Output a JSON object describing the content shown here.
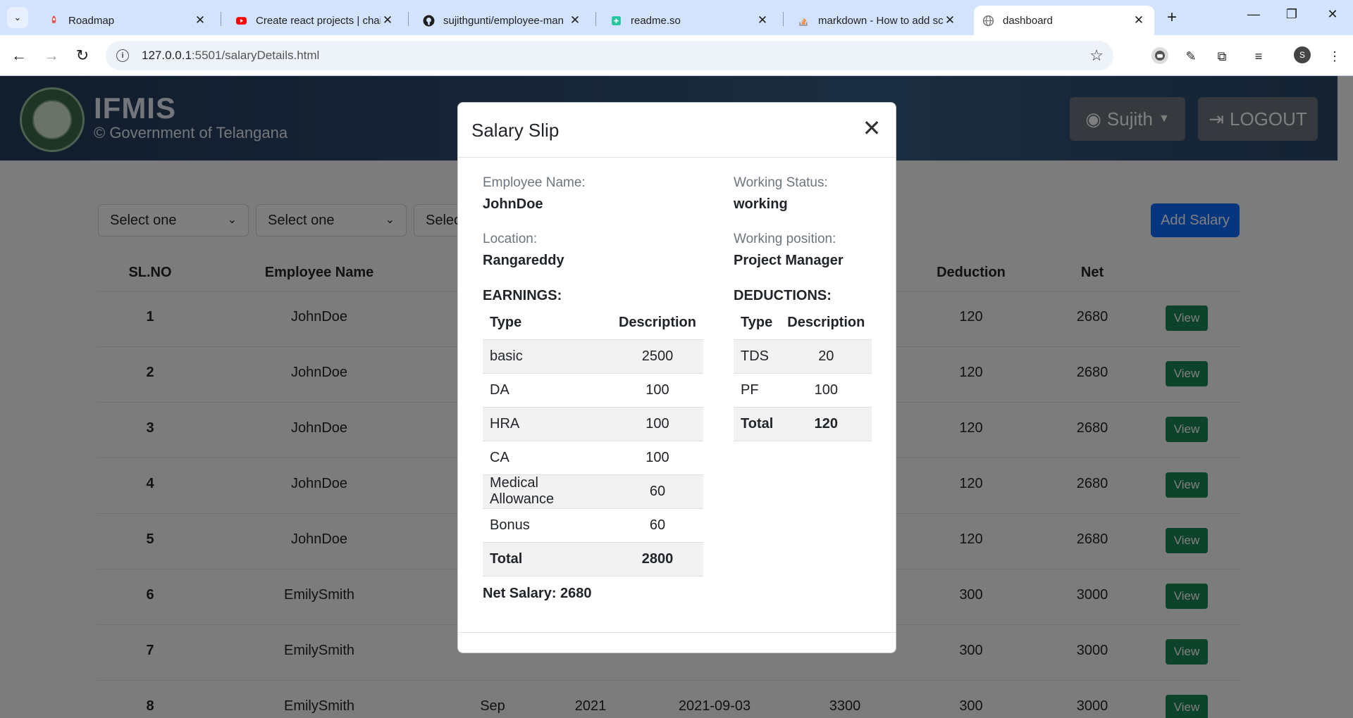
{
  "browser": {
    "tabs": [
      {
        "title": "Roadmap",
        "icon": "roadmap-rocket-icon"
      },
      {
        "title": "Create react projects | chai",
        "icon": "youtube-icon"
      },
      {
        "title": "sujithgunti/employee-man",
        "icon": "github-icon"
      },
      {
        "title": "readme.so",
        "icon": "readme-icon"
      },
      {
        "title": "markdown - How to add sc",
        "icon": "stackoverflow-icon"
      },
      {
        "title": "dashboard",
        "icon": "globe-icon"
      }
    ],
    "url_host": "127.0.0.1",
    "url_path": ":5501/salaryDetails.html",
    "profile_initial": "S"
  },
  "header": {
    "brand_title": "IFMIS",
    "brand_subtitle": "© Government of Telangana",
    "user_label": "Sujith",
    "logout_label": "LOGOUT"
  },
  "filters": {
    "select1": "Select one",
    "select2": "Select one",
    "select3": "Selec",
    "add_salary_label": "Add Salary"
  },
  "table": {
    "columns": {
      "sl_no": "SL.NO",
      "employee_name": "Employee Name",
      "deduction": "Deduction",
      "net": "Net"
    },
    "view_label": "View",
    "rows": [
      {
        "sl": "1",
        "name": "JohnDoe",
        "month": "",
        "year": "",
        "date": "",
        "gross": "",
        "deduction": "120",
        "net": "2680"
      },
      {
        "sl": "2",
        "name": "JohnDoe",
        "month": "",
        "year": "",
        "date": "",
        "gross": "",
        "deduction": "120",
        "net": "2680"
      },
      {
        "sl": "3",
        "name": "JohnDoe",
        "month": "",
        "year": "",
        "date": "",
        "gross": "",
        "deduction": "120",
        "net": "2680"
      },
      {
        "sl": "4",
        "name": "JohnDoe",
        "month": "",
        "year": "",
        "date": "",
        "gross": "",
        "deduction": "120",
        "net": "2680"
      },
      {
        "sl": "5",
        "name": "JohnDoe",
        "month": "",
        "year": "",
        "date": "",
        "gross": "",
        "deduction": "120",
        "net": "2680"
      },
      {
        "sl": "6",
        "name": "EmilySmith",
        "month": "",
        "year": "",
        "date": "",
        "gross": "",
        "deduction": "300",
        "net": "3000"
      },
      {
        "sl": "7",
        "name": "EmilySmith",
        "month": "",
        "year": "",
        "date": "",
        "gross": "",
        "deduction": "300",
        "net": "3000"
      },
      {
        "sl": "8",
        "name": "EmilySmith",
        "month": "Sep",
        "year": "2021",
        "date": "2021-09-03",
        "gross": "3300",
        "deduction": "300",
        "net": "3000"
      }
    ]
  },
  "modal": {
    "title": "Salary Slip",
    "employee_name_label": "Employee Name:",
    "employee_name": "JohnDoe",
    "working_status_label": "Working Status:",
    "working_status": "working",
    "location_label": "Location:",
    "location": "Rangareddy",
    "working_position_label": "Working position:",
    "working_position": "Project Manager",
    "earnings_title": "EARNINGS:",
    "deductions_title": "DEDUCTIONS:",
    "col_type": "Type",
    "col_description": "Description",
    "earnings": [
      {
        "type": "basic",
        "value": "2500"
      },
      {
        "type": "DA",
        "value": "100"
      },
      {
        "type": "HRA",
        "value": "100"
      },
      {
        "type": "CA",
        "value": "100"
      },
      {
        "type": "Medical Allowance",
        "value": "60"
      },
      {
        "type": "Bonus",
        "value": "60"
      }
    ],
    "earnings_total_label": "Total",
    "earnings_total": "2800",
    "deductions": [
      {
        "type": "TDS",
        "value": "20"
      },
      {
        "type": "PF",
        "value": "100"
      }
    ],
    "deductions_total_label": "Total",
    "deductions_total": "120",
    "net_salary": "Net Salary: 2680"
  }
}
